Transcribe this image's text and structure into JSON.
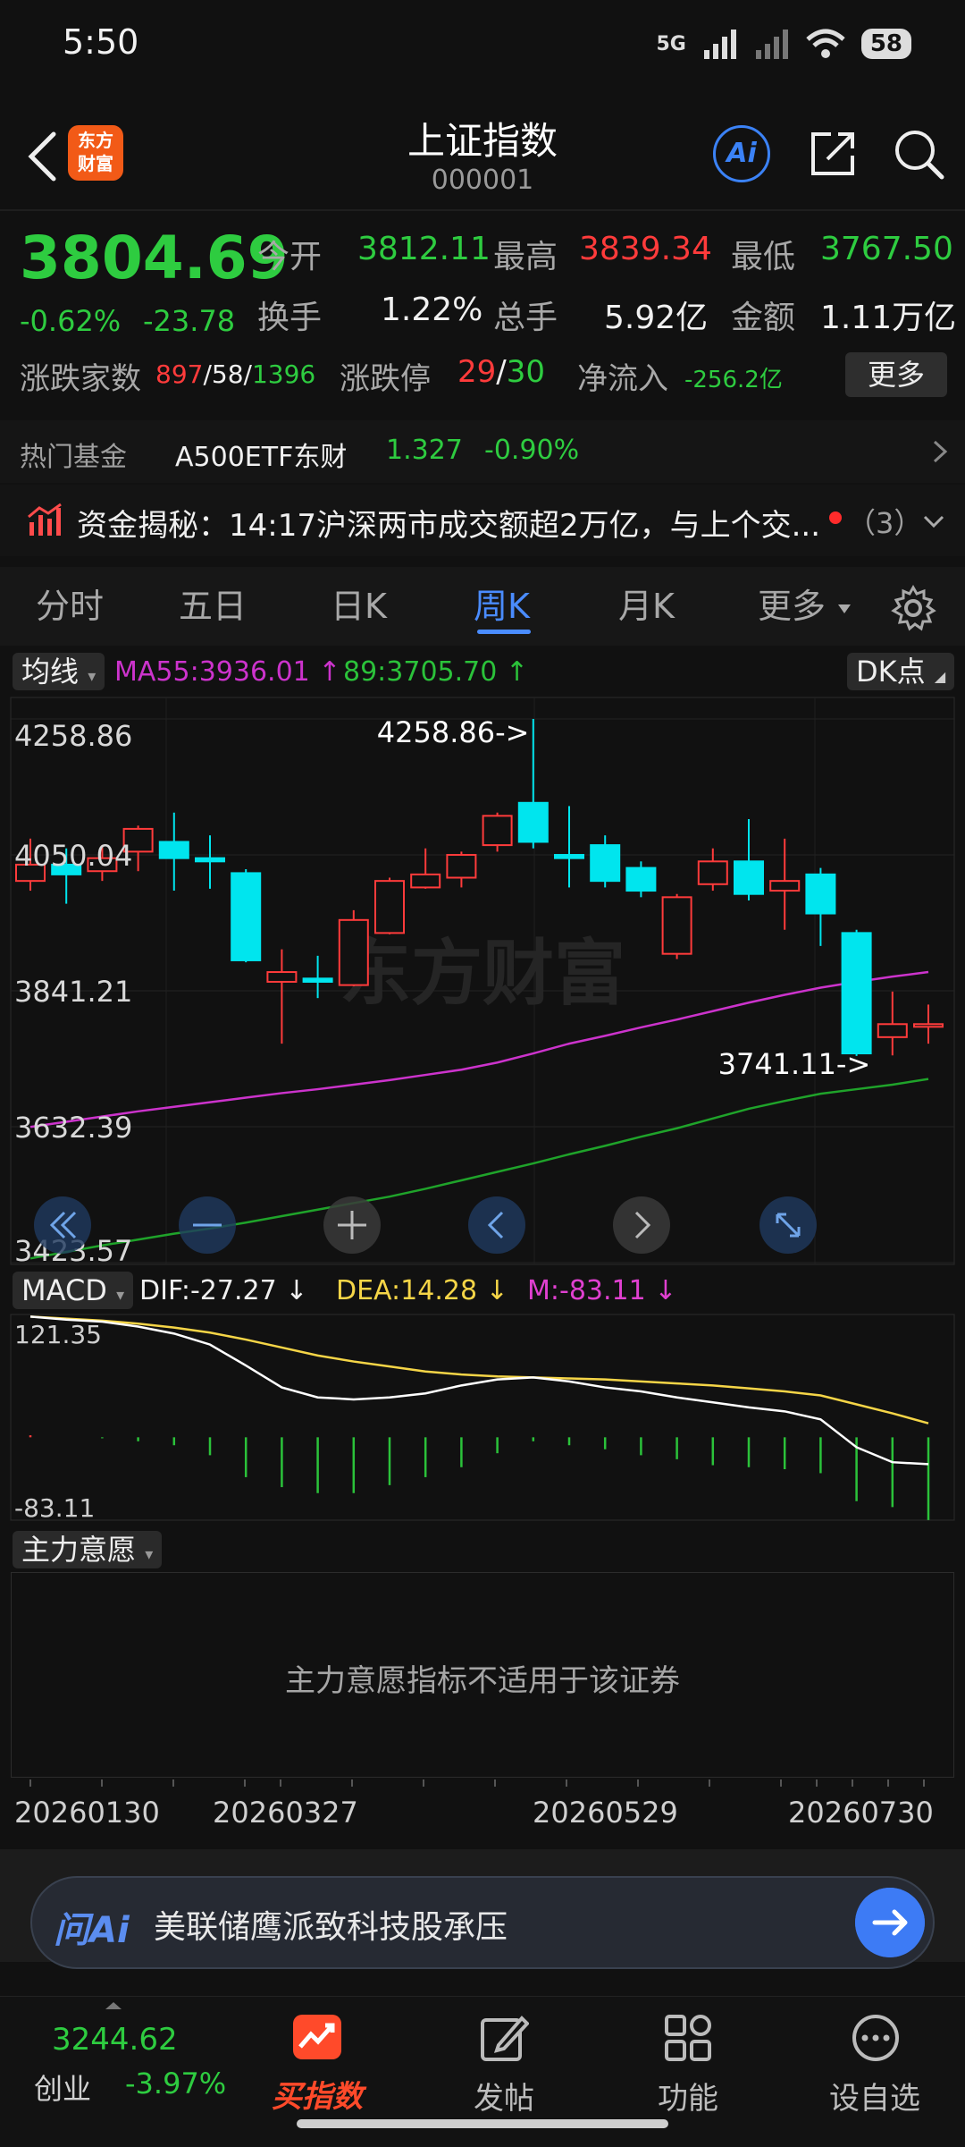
{
  "status": {
    "time": "5:50",
    "network": "5G",
    "battery": "58"
  },
  "header": {
    "logo_line1": "东方",
    "logo_line2": "财富",
    "title": "上证指数",
    "code": "000001",
    "ai_label": "Ai"
  },
  "quote": {
    "price": "3804.69",
    "change_pct": "-0.62%",
    "change": "-23.78",
    "open_label": "今开",
    "open": "3812.11",
    "high_label": "最高",
    "high": "3839.34",
    "low_label": "最低",
    "low": "3767.50",
    "turnover_label": "换手",
    "turnover": "1.22%",
    "volume_label": "总手",
    "volume": "5.92亿",
    "amount_label": "金额",
    "amount": "1.11万亿",
    "breadth_label": "涨跌家数",
    "breadth_up": "897",
    "breadth_flat": "58",
    "breadth_down": "1396",
    "limit_label": "涨跌停",
    "limit_up": "29",
    "limit_down": "30",
    "netflow_label": "净流入",
    "netflow": "-256.2亿",
    "more_label": "更多"
  },
  "hot_fund": {
    "label": "热门基金",
    "name": "A500ETF东财",
    "price": "1.327",
    "change": "-0.90%"
  },
  "news": {
    "text": "资金揭秘：14:17沪深两市成交额超2万亿，与上个交...",
    "count": "（3）"
  },
  "tabs": [
    {
      "label": "分时"
    },
    {
      "label": "五日"
    },
    {
      "label": "日K"
    },
    {
      "label": "周K",
      "active": true
    },
    {
      "label": "月K"
    },
    {
      "label": "更多"
    }
  ],
  "chart_header": {
    "ma_dropdown": "均线",
    "ma55": "MA55:3936.01",
    "ma89": "89:3705.70",
    "dk_label": "DK点"
  },
  "chart_data": {
    "type": "candlestick",
    "y_labels": [
      "4258.86",
      "4050.04",
      "3841.21",
      "3632.39",
      "3423.57"
    ],
    "ylim": [
      3423.57,
      4258.86
    ],
    "max_annotation": "4258.86->",
    "min_annotation": "3741.11->",
    "watermark": "东方财富",
    "candles": [
      {
        "o": 4010,
        "c": 4035,
        "h": 4075,
        "l": 3995
      },
      {
        "o": 4035,
        "c": 4020,
        "h": 4060,
        "l": 3975
      },
      {
        "o": 4025,
        "c": 4045,
        "h": 4065,
        "l": 4010
      },
      {
        "o": 4055,
        "c": 4090,
        "h": 4095,
        "l": 4025
      },
      {
        "o": 4070,
        "c": 4045,
        "h": 4115,
        "l": 3995
      },
      {
        "o": 4045,
        "c": 4040,
        "h": 4080,
        "l": 3998
      },
      {
        "o": 4022,
        "c": 3888,
        "h": 4028,
        "l": 3885
      },
      {
        "o": 3855,
        "c": 3870,
        "h": 3905,
        "l": 3760
      },
      {
        "o": 3860,
        "c": 3855,
        "h": 3895,
        "l": 3830
      },
      {
        "o": 3850,
        "c": 3950,
        "h": 3965,
        "l": 3848
      },
      {
        "o": 3930,
        "c": 4010,
        "h": 4015,
        "l": 3928
      },
      {
        "o": 4000,
        "c": 4020,
        "h": 4060,
        "l": 3998
      },
      {
        "o": 4015,
        "c": 4050,
        "h": 4055,
        "l": 4000
      },
      {
        "o": 4065,
        "c": 4110,
        "h": 4115,
        "l": 4055
      },
      {
        "o": 4130,
        "c": 4070,
        "h": 4258.86,
        "l": 4060
      },
      {
        "o": 4050,
        "c": 4045,
        "h": 4125,
        "l": 4000
      },
      {
        "o": 4065,
        "c": 4010,
        "h": 4080,
        "l": 4000
      },
      {
        "o": 4030,
        "c": 3995,
        "h": 4040,
        "l": 3985
      },
      {
        "o": 3898,
        "c": 3985,
        "h": 3990,
        "l": 3890
      },
      {
        "o": 4005,
        "c": 4040,
        "h": 4060,
        "l": 3995
      },
      {
        "o": 4040,
        "c": 3990,
        "h": 4105,
        "l": 3980
      },
      {
        "o": 3995,
        "c": 4010,
        "h": 4075,
        "l": 3935
      },
      {
        "o": 4020,
        "c": 3960,
        "h": 4030,
        "l": 3910
      },
      {
        "o": 3930,
        "c": 3745,
        "h": 3935,
        "l": 3741.11
      },
      {
        "o": 3770,
        "c": 3790,
        "h": 3840,
        "l": 3742
      },
      {
        "o": 3790,
        "c": 3790,
        "h": 3820,
        "l": 3760
      }
    ],
    "ma55": [
      3632,
      3640,
      3648,
      3656,
      3663,
      3670,
      3677,
      3684,
      3690,
      3697,
      3704,
      3712,
      3720,
      3731,
      3745,
      3760,
      3772,
      3785,
      3797,
      3810,
      3823,
      3835,
      3846,
      3855,
      3863,
      3870
    ],
    "ma89": [
      3430,
      3440,
      3450,
      3459,
      3468,
      3476,
      3485,
      3495,
      3505,
      3515,
      3525,
      3537,
      3550,
      3563,
      3576,
      3590,
      3603,
      3617,
      3630,
      3645,
      3660,
      3672,
      3683,
      3690,
      3697,
      3705.7
    ]
  },
  "macd": {
    "dropdown": "MACD",
    "dif": "DIF:-27.27",
    "dea": "DEA:14.28",
    "m": "M:-83.11",
    "y_top": "121.35",
    "y_bottom": "-83.11",
    "dif_line": [
      121,
      118,
      116,
      111,
      104,
      93,
      72,
      50,
      40,
      38,
      40,
      44,
      52,
      58,
      60,
      56,
      50,
      46,
      40,
      35,
      30,
      26,
      18,
      -10,
      -25,
      -27
    ],
    "dea_line": [
      121,
      119,
      117,
      114,
      110,
      105,
      98,
      90,
      82,
      76,
      71,
      66,
      63,
      61,
      60,
      59,
      58,
      56,
      54,
      52,
      49,
      46,
      42,
      33,
      24,
      14
    ],
    "hist": [
      2,
      0,
      -1,
      -4,
      -8,
      -18,
      -40,
      -50,
      -56,
      -56,
      -48,
      -40,
      -30,
      -16,
      -4,
      -8,
      -12,
      -18,
      -22,
      -28,
      -30,
      -32,
      -36,
      -64,
      -70,
      -83
    ]
  },
  "zhuli": {
    "dropdown": "主力意愿",
    "message": "主力意愿指标不适用于该证券"
  },
  "date_axis": [
    "20260130",
    "20260327",
    "20260529",
    "20260730"
  ],
  "ai_bar": {
    "logo": "问Ai",
    "text": "美联储鹰派致科技股承压"
  },
  "bottom_nav": {
    "index_value": "3244.62",
    "index_name": "创业",
    "index_change": "-3.97%",
    "buy_label": "买指数",
    "post_label": "发帖",
    "func_label": "功能",
    "watch_label": "设自选"
  },
  "colors": {
    "up": "#ff3b3b",
    "down": "#2ecc40",
    "accent": "#4a8cff",
    "cyan": "#00e5ee",
    "ma55": "#cc33cc",
    "ma89": "#1fa32a",
    "dea": "#f5d547"
  }
}
